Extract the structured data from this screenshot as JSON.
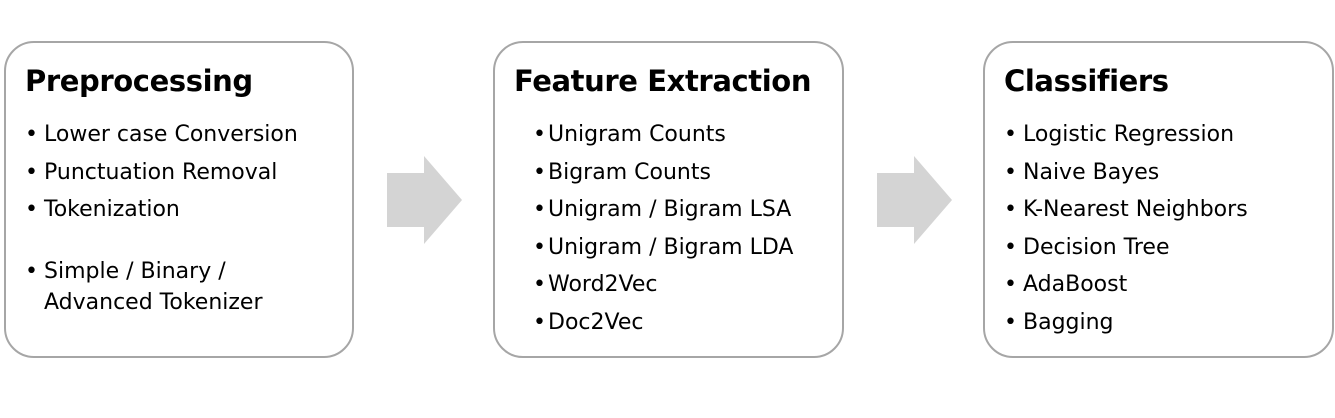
{
  "diagram": {
    "colors": {
      "box_border": "#a6a6a6",
      "arrow_fill": "#d4d4d4",
      "text": "#000000"
    },
    "stages": [
      {
        "title": "Preprocessing",
        "items": [
          {
            "lines": [
              "Lower case Conversion"
            ]
          },
          {
            "lines": [
              "Punctuation Removal"
            ]
          },
          {
            "lines": [
              "Tokenization"
            ]
          },
          {
            "lines": [
              "Simple / Binary /",
              "Advanced Tokenizer"
            ]
          }
        ]
      },
      {
        "title": "Feature Extraction",
        "items": [
          {
            "lines": [
              "Unigram Counts"
            ]
          },
          {
            "lines": [
              "Bigram Counts"
            ]
          },
          {
            "lines": [
              "Unigram / Bigram LSA"
            ]
          },
          {
            "lines": [
              "Unigram / Bigram LDA"
            ]
          },
          {
            "lines": [
              "Word2Vec"
            ]
          },
          {
            "lines": [
              "Doc2Vec"
            ]
          }
        ]
      },
      {
        "title": "Classifiers",
        "items": [
          {
            "lines": [
              "Logistic Regression"
            ]
          },
          {
            "lines": [
              "Naive Bayes"
            ]
          },
          {
            "lines": [
              "K-Nearest Neighbors"
            ]
          },
          {
            "lines": [
              "Decision Tree"
            ]
          },
          {
            "lines": [
              "AdaBoost"
            ]
          },
          {
            "lines": [
              "Bagging"
            ]
          }
        ]
      }
    ],
    "bullet": "•"
  }
}
